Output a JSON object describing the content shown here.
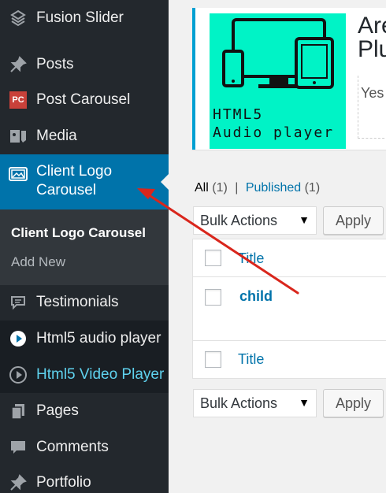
{
  "sidebar": {
    "items": [
      {
        "label": "Fusion Slider",
        "icon": "fusion-slider-icon"
      },
      {
        "label": "Posts",
        "icon": "pin-icon"
      },
      {
        "label": "Post Carousel",
        "icon": "pc-badge-icon",
        "badge": "PC"
      },
      {
        "label": "Media",
        "icon": "media-icon"
      },
      {
        "label": "Client Logo Carousel",
        "icon": "image-frame-icon",
        "current": true
      },
      {
        "label": "Testimonials",
        "icon": "testimonial-icon"
      },
      {
        "label": "Html5 audio player",
        "icon": "play-circle-icon"
      },
      {
        "label": "Html5 Video Player",
        "icon": "play-circle-outline-icon"
      },
      {
        "label": "Pages",
        "icon": "pages-icon"
      },
      {
        "label": "Comments",
        "icon": "comment-icon"
      },
      {
        "label": "Portfolio",
        "icon": "pin-icon"
      }
    ],
    "submenu": [
      {
        "label": "Client Logo Carousel",
        "active": true
      },
      {
        "label": "Add New"
      }
    ]
  },
  "notice": {
    "heading_line1": "Are",
    "heading_line2": "Plu",
    "text": "Yes",
    "promo_line1": "HTML5",
    "promo_line2": "Audio player"
  },
  "filters": {
    "all_label": "All",
    "all_count": "(1)",
    "separator": "|",
    "published_label": "Published",
    "published_count": "(1)"
  },
  "bulk_top": {
    "select_value": "Bulk Actions",
    "apply_label": "Apply"
  },
  "bulk_bottom": {
    "select_value": "Bulk Actions",
    "apply_label": "Apply"
  },
  "table": {
    "header_title": "Title",
    "footer_title": "Title",
    "rows": [
      {
        "title": "child"
      }
    ]
  },
  "colors": {
    "sidebar_bg": "#23282d",
    "current_bg": "#0073aa",
    "link": "#0073aa",
    "promo_bg": "#00f3c6",
    "arrow": "#d9261c"
  }
}
